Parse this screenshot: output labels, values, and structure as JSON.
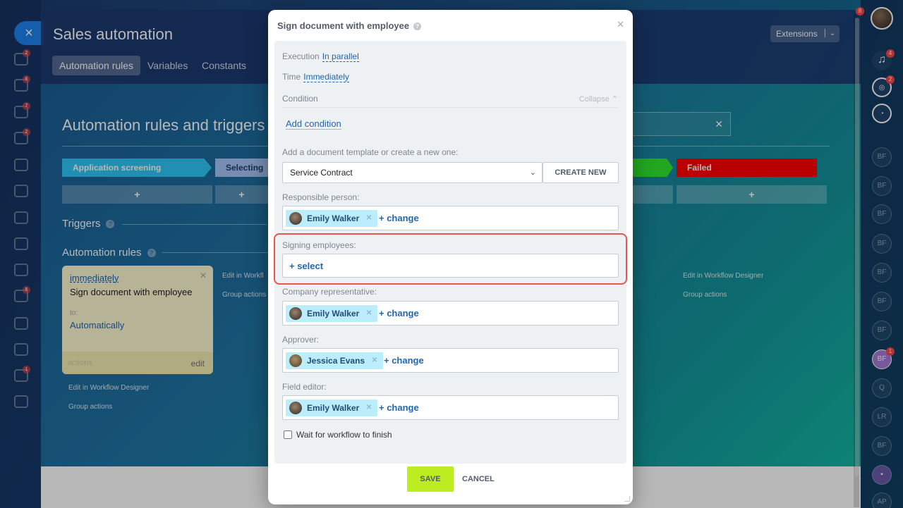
{
  "background": {
    "panel_title": "Sales automation",
    "extensions_label": "Extensions",
    "tabs": [
      {
        "label": "Automation rules",
        "active": true
      },
      {
        "label": "Variables",
        "active": false
      },
      {
        "label": "Constants",
        "active": false
      }
    ],
    "heading": "Automation rules and triggers",
    "stages": [
      {
        "label": "Application screening",
        "color": "#2fc6f6"
      },
      {
        "label": "Selecting",
        "color": "#a7c4f5"
      },
      {
        "label": "",
        "color": "#2fe82f"
      },
      {
        "label": "Failed",
        "color": "#ff0000"
      }
    ],
    "plus": "+",
    "triggers_label": "Triggers",
    "rules_label": "Automation rules",
    "rule_card": {
      "when": "immediately",
      "name": "Sign document with employee",
      "to_label": "to:",
      "to_value": "Automatically",
      "actions": "actions",
      "edit": "edit"
    },
    "links": {
      "edit_designer": "Edit in Workflow Designer",
      "edit_designer_short": "Edit in Workfl",
      "group_actions": "Group actions",
      "group_actions_short": "Group actions"
    }
  },
  "right_rail": {
    "avatars": [
      "BF",
      "BF",
      "BF",
      "BF",
      "BF",
      "BF",
      "BF",
      "BF",
      "Q",
      "LR",
      "BF",
      "AP"
    ],
    "badges": {
      "notifications": "4",
      "feed": "2",
      "active_avatar": "1",
      "top": "8"
    }
  },
  "left_rail": {
    "badges": [
      "2",
      "6",
      "7",
      "2",
      "6",
      "1"
    ]
  },
  "modal": {
    "title": "Sign document with employee",
    "execution_label": "Execution",
    "execution_value": "In parallel",
    "time_label": "Time",
    "time_value": "Immediately",
    "condition_label": "Condition",
    "collapse_label": "Collapse",
    "add_condition": "Add condition",
    "template_label": "Add a document template or create a new one:",
    "template_value": "Service Contract",
    "create_new": "CREATE NEW",
    "responsible_label": "Responsible person:",
    "responsible_user": "Emily Walker",
    "change": "+ change",
    "signing_label": "Signing employees:",
    "select": "+ select",
    "company_rep_label": "Company representative:",
    "company_rep_user": "Emily Walker",
    "approver_label": "Approver:",
    "approver_user": "Jessica Evans",
    "field_editor_label": "Field editor:",
    "field_editor_user": "Emily Walker",
    "wait_label": "Wait for workflow to finish",
    "save": "SAVE",
    "cancel": "CANCEL",
    "highlight_color": "#e8564f",
    "save_color": "#bbed21"
  }
}
